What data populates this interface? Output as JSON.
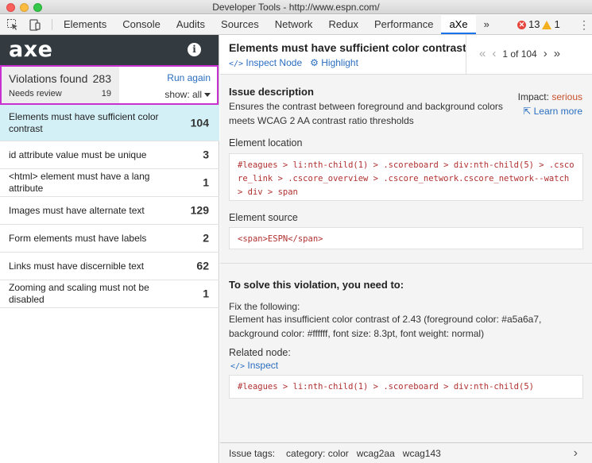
{
  "window": {
    "title": "Developer Tools - http://www.espn.com/"
  },
  "devtools": {
    "tabs": [
      "Elements",
      "Console",
      "Audits",
      "Sources",
      "Network",
      "Redux",
      "Performance",
      "aXe"
    ],
    "active_tab": "aXe",
    "more": "»",
    "error_count": "13",
    "warning_count": "1",
    "error_glyph": "✕",
    "warning_glyph": "!"
  },
  "axe": {
    "logo": "axe",
    "info_glyph": "i",
    "violations_label": "Violations found",
    "violations_count": "283",
    "review_label": "Needs review",
    "review_count": "19",
    "run_again": "Run again",
    "show_filter": "show: all"
  },
  "violations": [
    {
      "label": "Elements must have sufficient color contrast",
      "count": "104"
    },
    {
      "label": "id attribute value must be unique",
      "count": "3"
    },
    {
      "label": "<html> element must have a lang attribute",
      "count": "1"
    },
    {
      "label": "Images must have alternate text",
      "count": "129"
    },
    {
      "label": "Form elements must have labels",
      "count": "2"
    },
    {
      "label": "Links must have discernible text",
      "count": "62"
    },
    {
      "label": "Zooming and scaling must not be disabled",
      "count": "1"
    }
  ],
  "detail": {
    "title": "Elements must have sufficient color contrast",
    "inspect_node": "Inspect Node",
    "highlight": "Highlight",
    "pager": {
      "text": "1 of 104",
      "first": "«",
      "prev": "‹",
      "next": "›",
      "last": "»"
    },
    "issue_heading": "Issue description",
    "issue_text": "Ensures the contrast between foreground and background colors meets WCAG 2 AA contrast ratio thresholds",
    "impact_label": "Impact:",
    "impact_value": "serious",
    "learn_more": "Learn more",
    "location_label": "Element location",
    "location_code": "#leagues > li:nth-child(1) > .scoreboard > div:nth-child(5) > .cscore_link > .cscore_overview > .cscore_network.cscore_network--watch > div > span",
    "source_label": "Element source",
    "source_code": "<span>ESPN</span>",
    "solve_heading": "To solve this violation, you need to:",
    "fix_label": "Fix the following:",
    "fix_text": "Element has insufficient color contrast of 2.43 (foreground color: #a5a6a7, background color: #ffffff, font size: 8.3pt, font weight: normal)",
    "related_label": "Related node:",
    "inspect": "Inspect",
    "related_code": "#leagues > li:nth-child(1) > .scoreboard > div:nth-child(5)"
  },
  "footer": {
    "label": "Issue tags:",
    "tags": [
      "category: color",
      "wcag2aa",
      "wcag143"
    ],
    "chevron": "›"
  },
  "colors": {
    "selected_row": "#d4f0f7",
    "accent": "#2a6ebf",
    "summary_border": "#c830d0",
    "axe_header": "#333b40",
    "impact": "#c8512c"
  }
}
